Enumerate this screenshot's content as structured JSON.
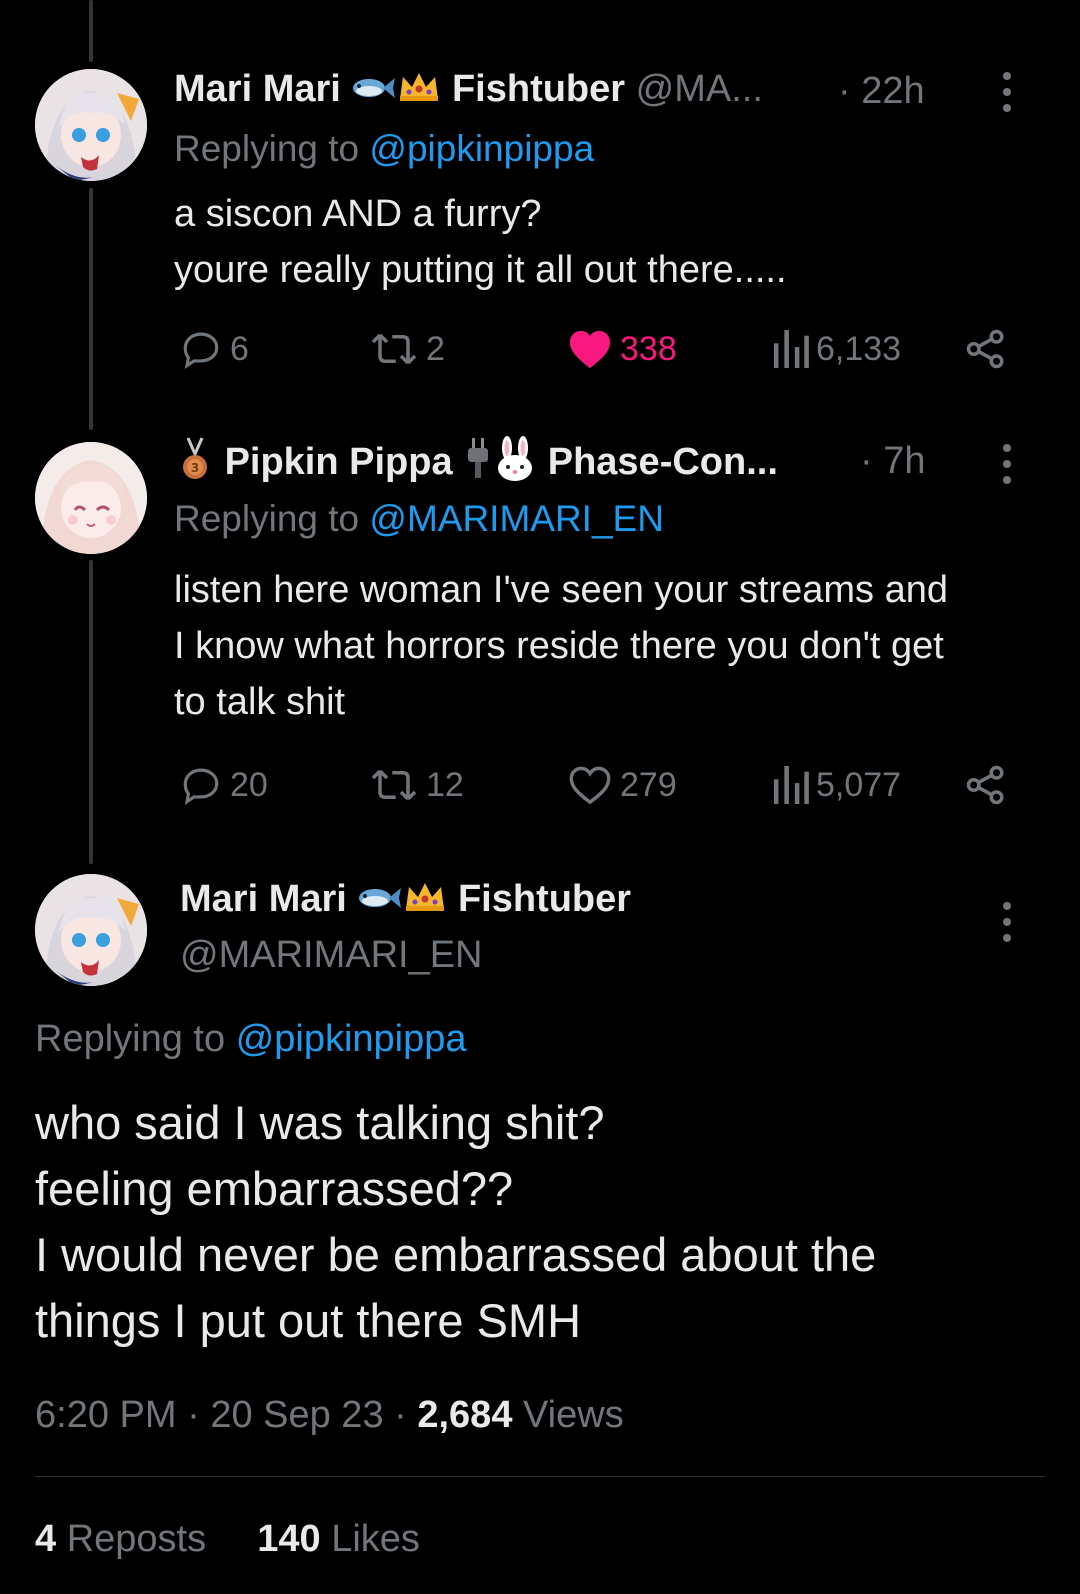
{
  "tweets": [
    {
      "display_name": "Mari Mari",
      "name_suffix": "Fishtuber",
      "handle": "@MA...",
      "time": "· 22h",
      "replying_prefix": "Replying to",
      "replying_to": "@pipkinpippa",
      "text_lines": [
        "a siscon AND a furry?",
        "youre really putting it all out there....."
      ],
      "stats": {
        "replies": "6",
        "reposts": "2",
        "likes": "338",
        "views": "6,133"
      },
      "liked": true,
      "icons": [
        "fish-icon",
        "crown-icon"
      ]
    },
    {
      "display_name": "Pipkin Pippa",
      "name_suffix": "Phase-Con...",
      "time": "· 7h",
      "replying_prefix": "Replying to",
      "replying_to": "@MARIMARI_EN",
      "text_lines": [
        "listen here woman I've seen your streams and",
        "I know what horrors reside there you don't get",
        "to talk shit"
      ],
      "stats": {
        "replies": "20",
        "reposts": "12",
        "likes": "279",
        "views": "5,077"
      },
      "liked": false,
      "icons": [
        "medal-icon",
        "plug-icon",
        "rabbit-icon"
      ]
    }
  ],
  "main_tweet": {
    "display_name": "Mari Mari",
    "name_suffix": "Fishtuber",
    "handle": "@MARIMARI_EN",
    "replying_prefix": "Replying to",
    "replying_to": "@pipkinpippa",
    "text_lines": [
      "who said I was talking shit?",
      "feeling embarrassed??",
      "I would never be embarrassed about the",
      "things I put out there SMH"
    ],
    "time": "6:20 PM",
    "date": "20 Sep 23",
    "views_count": "2,684",
    "views_label": "Views",
    "reposts_count": "4",
    "reposts_label": "Reposts",
    "likes_count": "140",
    "likes_label": "Likes"
  },
  "colors": {
    "like_pink": "#f91880",
    "link_blue": "#1d9bf0",
    "muted": "#71767b",
    "text": "#e7e9ea",
    "background": "#000000"
  }
}
